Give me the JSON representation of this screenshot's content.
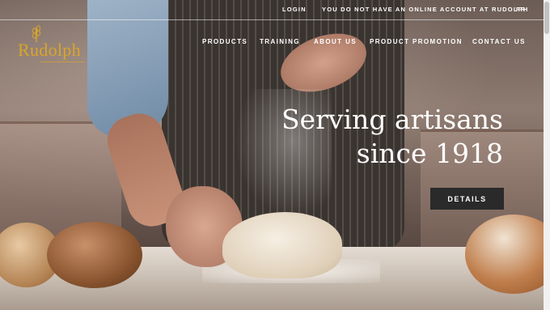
{
  "topbar": {
    "login": "LOGIN",
    "account_notice": "YOU DO NOT HAVE AN ONLINE ACCOUNT AT RUDOLPH",
    "language": "FR"
  },
  "logo": {
    "text": "Rudolph",
    "icon": "wheat-icon",
    "color": "#d9a52b"
  },
  "nav": {
    "items": [
      "PRODUCTS",
      "TRAINING",
      "ABOUT US",
      "PRODUCT PROMOTION",
      "CONTACT US"
    ]
  },
  "hero": {
    "headline_line1": "Serving artisans",
    "headline_line2": "since 1918",
    "button_label": "DETAILS",
    "button_color": "#2a2a2a"
  }
}
